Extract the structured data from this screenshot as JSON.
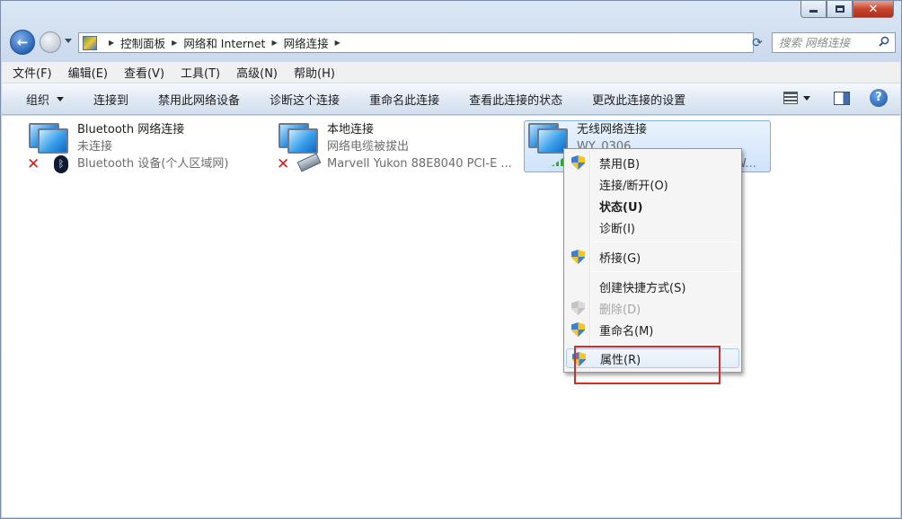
{
  "breadcrumb": [
    "控制面板",
    "网络和 Internet",
    "网络连接"
  ],
  "search": {
    "placeholder": "搜索 网络连接"
  },
  "menubar": [
    "文件(F)",
    "编辑(E)",
    "查看(V)",
    "工具(T)",
    "高级(N)",
    "帮助(H)"
  ],
  "commands": {
    "organize": "组织",
    "items": [
      "连接到",
      "禁用此网络设备",
      "诊断这个连接",
      "重命名此连接",
      "查看此连接的状态",
      "更改此连接的设置"
    ]
  },
  "connections": [
    {
      "name": "Bluetooth 网络连接",
      "status": "未连接",
      "device": "Bluetooth 设备(个人区域网)"
    },
    {
      "name": "本地连接",
      "status": "网络电缆被拔出",
      "device": "Marvell Yukon 88E8040 PCI-E ..."
    },
    {
      "name": "无线网络连接",
      "status": "WY_0306",
      "device": "W..."
    }
  ],
  "context_menu": {
    "items": [
      "禁用(B)",
      "连接/断开(O)",
      "状态(U)",
      "诊断(I)",
      "桥接(G)",
      "创建快捷方式(S)",
      "删除(D)",
      "重命名(M)",
      "属性(R)"
    ]
  },
  "colors": {
    "highlight_box": "#d42b2b",
    "selection": "#cfe3fb"
  }
}
